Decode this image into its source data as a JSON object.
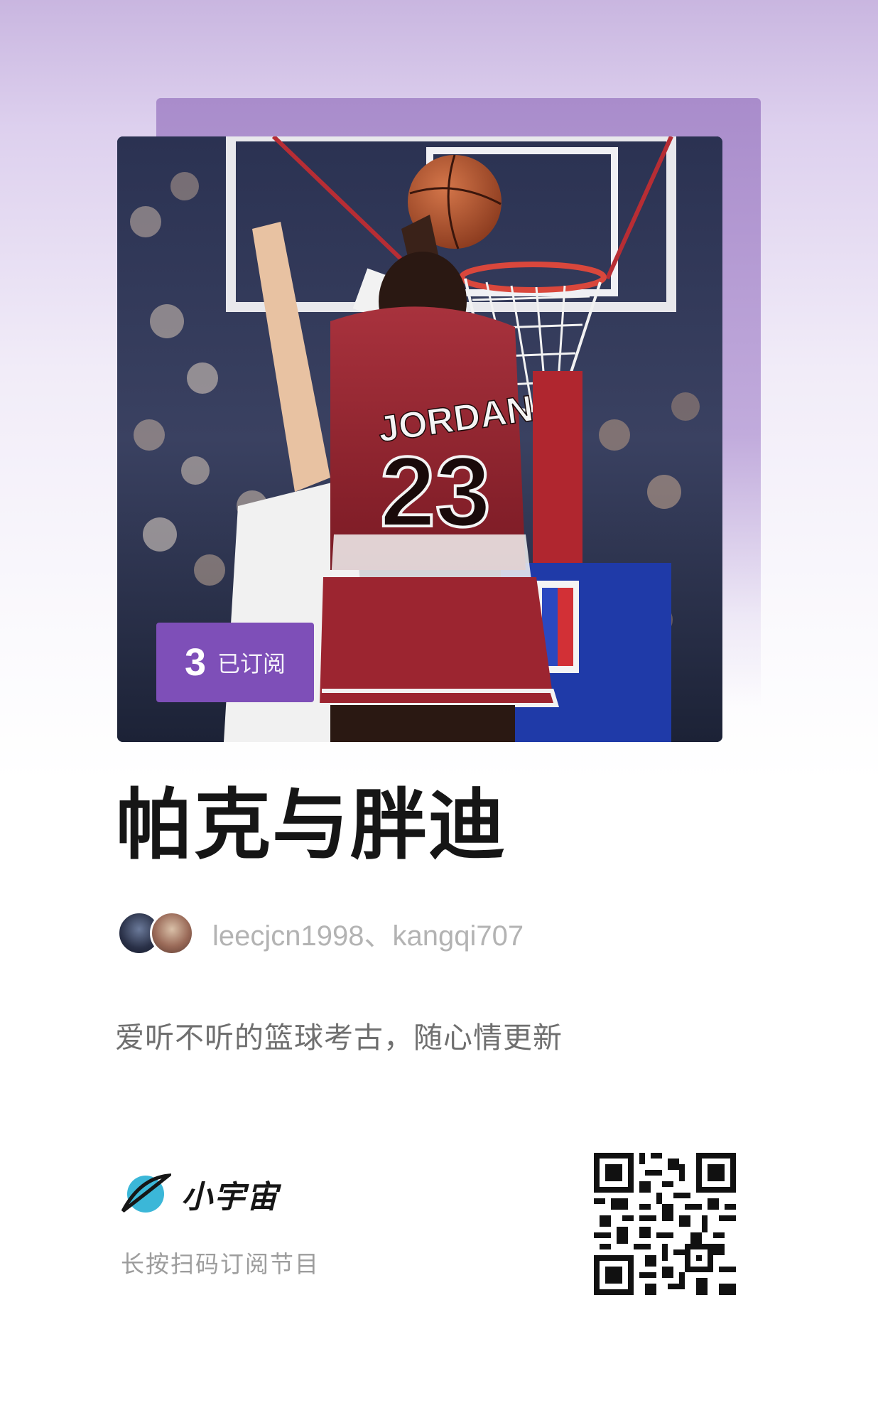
{
  "podcast": {
    "title": "帕克与胖迪",
    "authors_text": "leecjcn1998、kangqi707",
    "description": "爱听不听的篮球考古，随心情更新",
    "cover": {
      "subscribed_count": "3",
      "subscribed_label": "已订阅",
      "jersey_name": "JORDAN",
      "jersey_number": "23"
    }
  },
  "brand": {
    "name": "小宇宙",
    "hint": "长按扫码订阅节目"
  },
  "colors": {
    "accent": "#7e4fb8",
    "title": "#161616",
    "muted": "#b3b3b3"
  }
}
